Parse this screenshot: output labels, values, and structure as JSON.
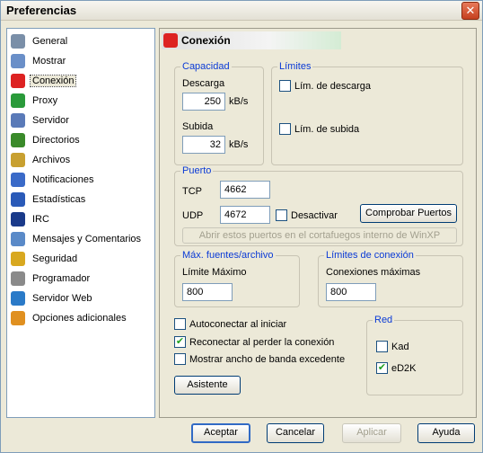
{
  "window": {
    "title": "Preferencias",
    "close_label": "✕"
  },
  "sidebar": {
    "items": [
      {
        "label": "General",
        "icon": "general-icon"
      },
      {
        "label": "Mostrar",
        "icon": "display-icon"
      },
      {
        "label": "Conexión",
        "icon": "connection-icon",
        "selected": true
      },
      {
        "label": "Proxy",
        "icon": "proxy-icon"
      },
      {
        "label": "Servidor",
        "icon": "server-icon"
      },
      {
        "label": "Directorios",
        "icon": "folders-icon"
      },
      {
        "label": "Archivos",
        "icon": "files-icon"
      },
      {
        "label": "Notificaciones",
        "icon": "notifications-icon"
      },
      {
        "label": "Estadísticas",
        "icon": "statistics-icon"
      },
      {
        "label": "IRC",
        "icon": "irc-icon"
      },
      {
        "label": "Mensajes y Comentarios",
        "icon": "messages-icon"
      },
      {
        "label": "Seguridad",
        "icon": "security-icon"
      },
      {
        "label": "Programador",
        "icon": "scheduler-icon"
      },
      {
        "label": "Servidor Web",
        "icon": "webserver-icon"
      },
      {
        "label": "Opciones adicionales",
        "icon": "extra-options-icon"
      }
    ]
  },
  "panel": {
    "title": "Conexión",
    "capacidad": {
      "legend": "Capacidad",
      "descarga_label": "Descarga",
      "descarga_value": "250",
      "descarga_unit": "kB/s",
      "subida_label": "Subida",
      "subida_value": "32",
      "subida_unit": "kB/s"
    },
    "limites": {
      "legend": "Límites",
      "descarga_cb": "Lím. de descarga",
      "subida_cb": "Lím. de subida"
    },
    "puerto": {
      "legend": "Puerto",
      "tcp_label": "TCP",
      "tcp_value": "4662",
      "udp_label": "UDP",
      "udp_value": "4672",
      "desactivar": "Desactivar",
      "comprobar": "Comprobar Puertos",
      "abrir": "Abrir estos puertos en el cortafuegos interno de WinXP"
    },
    "fuentes": {
      "legend": "Máx. fuentes/archivo",
      "label": "Límite Máximo",
      "value": "800"
    },
    "conexion": {
      "legend": "Límites de conexión",
      "label": "Conexiones máximas",
      "value": "800"
    },
    "opciones": {
      "autoconectar": "Autoconectar al iniciar",
      "reconectar": "Reconectar al perder la conexión",
      "reconectar_checked": true,
      "mostrar": "Mostrar ancho de banda excedente"
    },
    "red": {
      "legend": "Red",
      "kad": "Kad",
      "kad_checked": false,
      "ed2k": "eD2K",
      "ed2k_checked": true
    },
    "asistente": "Asistente"
  },
  "footer": {
    "aceptar": "Aceptar",
    "cancelar": "Cancelar",
    "aplicar": "Aplicar",
    "ayuda": "Ayuda"
  },
  "icon_check": "✔"
}
